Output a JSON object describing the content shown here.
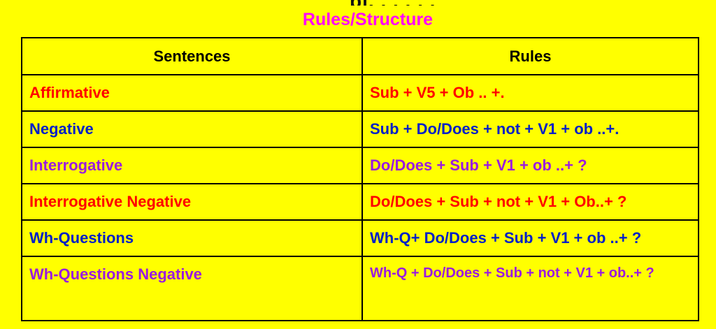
{
  "header": {
    "partial_title": "pi, , , , , ,",
    "subtitle": "Rules/Structure"
  },
  "table": {
    "columns": [
      "Sentences",
      "Rules"
    ],
    "rows": [
      {
        "sentence": "Affirmative",
        "rule": "Sub + V5 + Ob .. +.",
        "color": "#FF0000"
      },
      {
        "sentence": "Negative",
        "rule": "Sub + Do/Does + not + V1 + ob ..+.",
        "color": "#0020C8"
      },
      {
        "sentence": "Interrogative",
        "rule": "Do/Does + Sub + V1 + ob ..+ ?",
        "color": "#9A1BE0"
      },
      {
        "sentence": "Interrogative Negative",
        "rule": "Do/Does + Sub + not + V1 + Ob..+ ?",
        "color": "#FF0000"
      },
      {
        "sentence": "Wh-Questions",
        "rule": "Wh-Q+ Do/Does + Sub + V1 + ob ..+ ?",
        "color": "#0020C8"
      },
      {
        "sentence": "Wh-Questions Negative",
        "rule": "Wh-Q + Do/Does + Sub + not + V1 + ob..+ ?",
        "color": "#9A1BE0"
      }
    ]
  },
  "colors": {
    "background": "#FFFF00",
    "subtitle": "#FF00FF",
    "border": "#000000"
  }
}
